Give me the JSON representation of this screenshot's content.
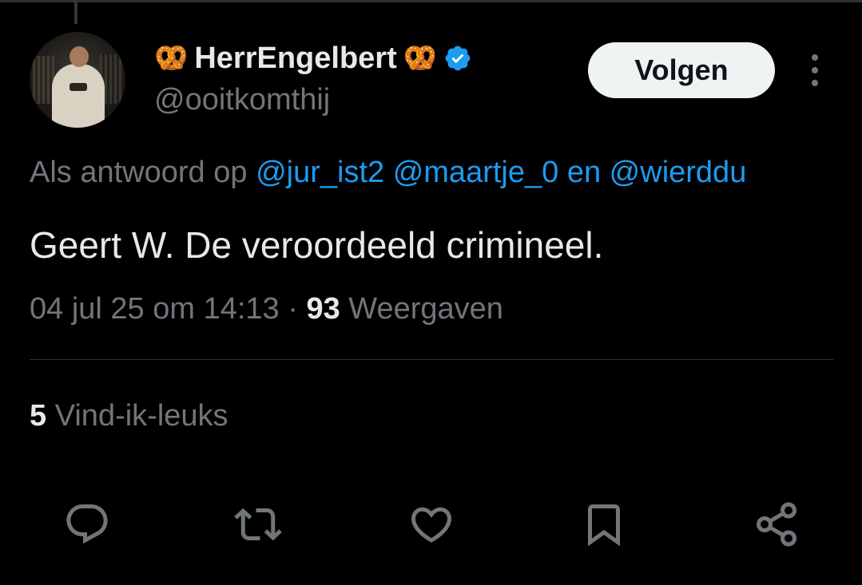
{
  "author": {
    "emoji_left": "🥨",
    "display_name": "HerrEngelbert",
    "emoji_right": "🥨",
    "handle": "@ooitkomthij"
  },
  "follow_label": "Volgen",
  "reply_context": {
    "prefix": "Als antwoord op",
    "mention1": "@jur_ist2",
    "mention2": "@maartje_0",
    "joiner": "en",
    "mention3": "@wierddu"
  },
  "tweet_text": "Geert W. De veroordeeld crimineel.",
  "meta": {
    "timestamp": "04 jul 25 om 14:13",
    "separator": "·",
    "views_count": "93",
    "views_label": "Weergaven"
  },
  "likes": {
    "count": "5",
    "label": "Vind-ik-leuks"
  },
  "colors": {
    "background": "#000000",
    "text": "#e7e9ea",
    "muted": "#71767b",
    "link": "#1d9bf0",
    "verified": "#1d9bf0"
  },
  "icons": [
    "reply-icon",
    "retweet-icon",
    "like-icon",
    "bookmark-icon",
    "share-icon"
  ]
}
